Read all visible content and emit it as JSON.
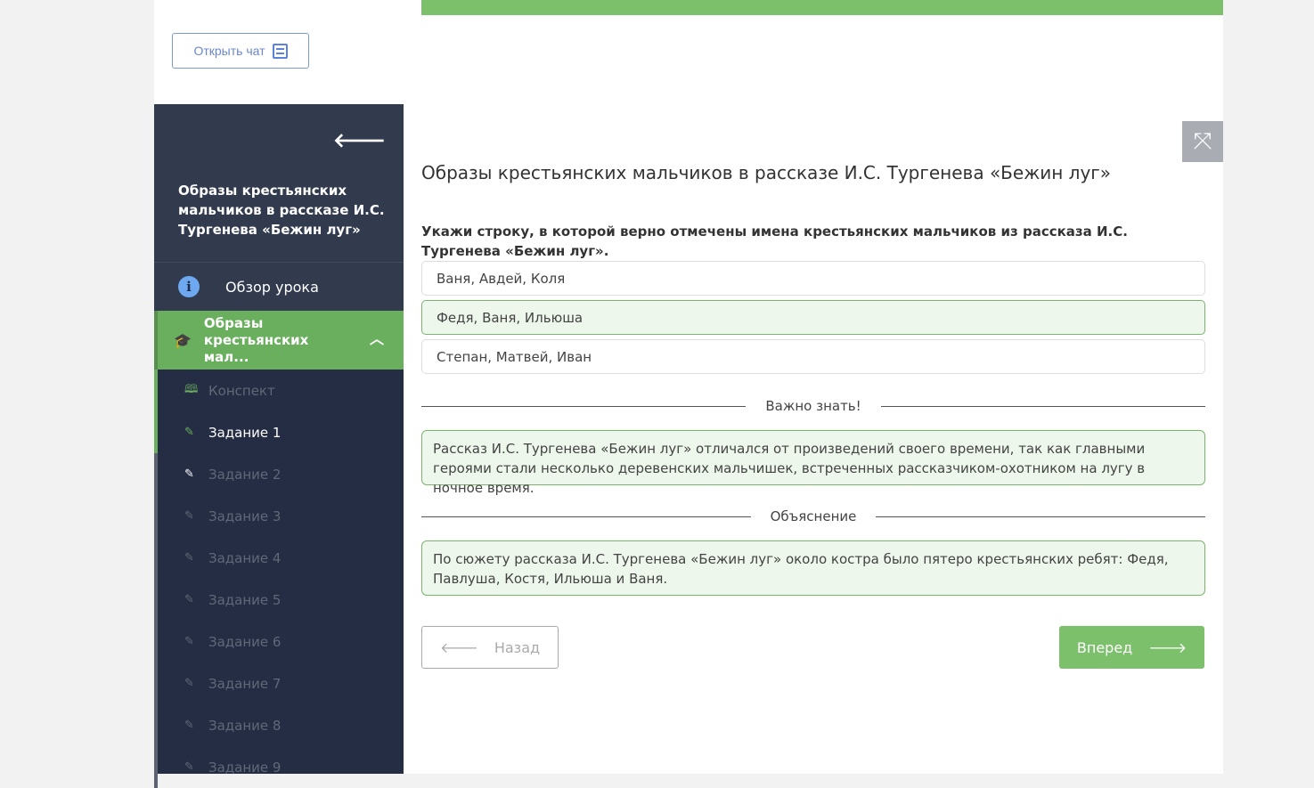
{
  "chat_button": "Открыть чат",
  "sidebar": {
    "title": "Образы крестьянских мальчиков в рассказе И.С. Тургенева «Бежин луг»",
    "overview": "Обзор урока",
    "module": "Образы крестьянских мал...",
    "items": [
      {
        "label": "Конспект"
      },
      {
        "label": "Задание 1"
      },
      {
        "label": "Задание 2"
      },
      {
        "label": "Задание 3"
      },
      {
        "label": "Задание 4"
      },
      {
        "label": "Задание 5"
      },
      {
        "label": "Задание 6"
      },
      {
        "label": "Задание 7"
      },
      {
        "label": "Задание 8"
      },
      {
        "label": "Задание 9"
      }
    ]
  },
  "main": {
    "title": "Образы крестьянских мальчиков в рассказе И.С. Тургенева «Бежин луг»",
    "question": "Укажи строку, в которой верно отмечены имена крестьянских мальчиков из рассказа И.С. Тургенева «Бежин луг».",
    "options": [
      "Ваня, Авдей, Коля",
      "Федя, Ваня, Ильюша",
      "Степан, Матвей, Иван"
    ],
    "important_label": "Важно знать!",
    "important_text": "Рассказ И.С. Тургенева «Бежин луг» отличался от произведений своего времени, так как главными героями стали несколько деревенских мальчишек, встреченных рассказчиком-охотником на лугу в ночное время.",
    "explanation_label": "Объяснение",
    "explanation_text": "По сюжету рассказа И.С. Тургенева «Бежин луг» около костра было пятеро крестьянских ребят: Федя, Павлуша, Костя, Ильюша и Ваня.",
    "back": "Назад",
    "next": "Вперед"
  }
}
